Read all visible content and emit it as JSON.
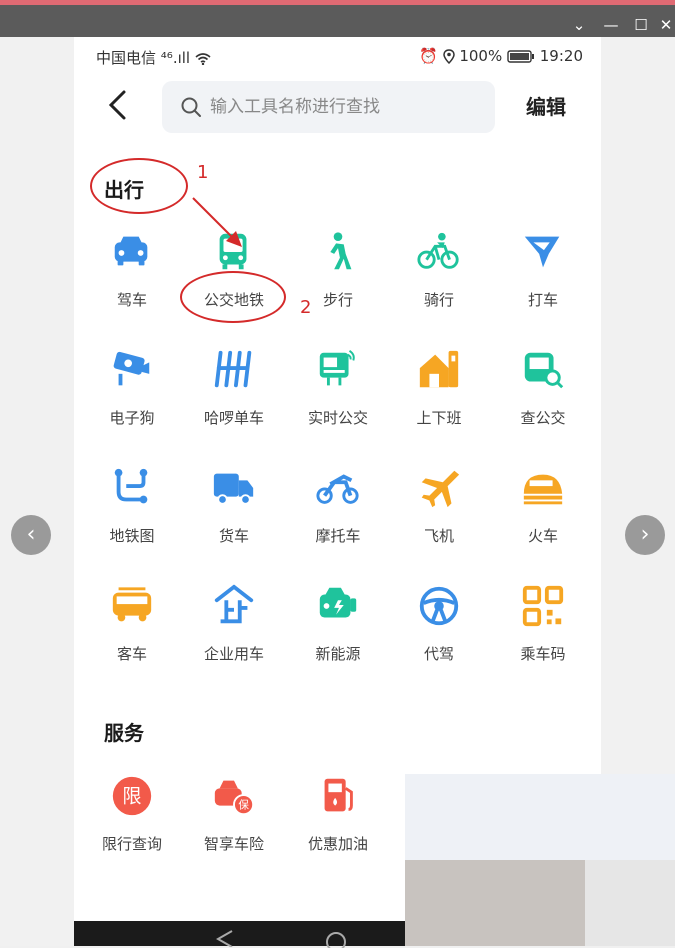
{
  "window": {
    "minimize_icon": "chevron-down-icon",
    "min": "—",
    "max": "☐",
    "close": "✕"
  },
  "status": {
    "carrier": "中国电信",
    "signal": "⁴⁶.ıll",
    "battery": "100%",
    "time": "19:20"
  },
  "search": {
    "placeholder": "输入工具名称进行查找",
    "edit": "编辑"
  },
  "sections": {
    "travel": "出行",
    "service": "服务"
  },
  "travel_tools": [
    {
      "label": "驾车",
      "icon": "car-icon"
    },
    {
      "label": "公交地铁",
      "icon": "bus-icon"
    },
    {
      "label": "步行",
      "icon": "walk-icon"
    },
    {
      "label": "骑行",
      "icon": "bike-icon"
    },
    {
      "label": "打车",
      "icon": "taxi-icon"
    },
    {
      "label": "电子狗",
      "icon": "camera-icon"
    },
    {
      "label": "哈啰单车",
      "icon": "hellobike-icon"
    },
    {
      "label": "实时公交",
      "icon": "realtime-bus-icon"
    },
    {
      "label": "上下班",
      "icon": "commute-icon"
    },
    {
      "label": "查公交",
      "icon": "bus-search-icon"
    },
    {
      "label": "地铁图",
      "icon": "subway-map-icon"
    },
    {
      "label": "货车",
      "icon": "truck-icon"
    },
    {
      "label": "摩托车",
      "icon": "motorcycle-icon"
    },
    {
      "label": "飞机",
      "icon": "plane-icon"
    },
    {
      "label": "火车",
      "icon": "train-icon"
    },
    {
      "label": "客车",
      "icon": "coach-icon"
    },
    {
      "label": "企业用车",
      "icon": "enterprise-car-icon"
    },
    {
      "label": "新能源",
      "icon": "ev-icon"
    },
    {
      "label": "代驾",
      "icon": "steering-wheel-icon"
    },
    {
      "label": "乘车码",
      "icon": "qr-code-icon"
    }
  ],
  "service_tools": [
    {
      "label": "限行查询",
      "icon": "restriction-icon"
    },
    {
      "label": "智享车险",
      "icon": "insurance-icon"
    },
    {
      "label": "优惠加油",
      "icon": "fuel-icon"
    }
  ],
  "annotations": {
    "one": "1",
    "two": "2"
  },
  "colors": {
    "blue": "#3a8ee6",
    "green": "#1fc39c",
    "orange": "#f6a623",
    "red": "#f25a4a",
    "annot": "#d42a2a"
  }
}
